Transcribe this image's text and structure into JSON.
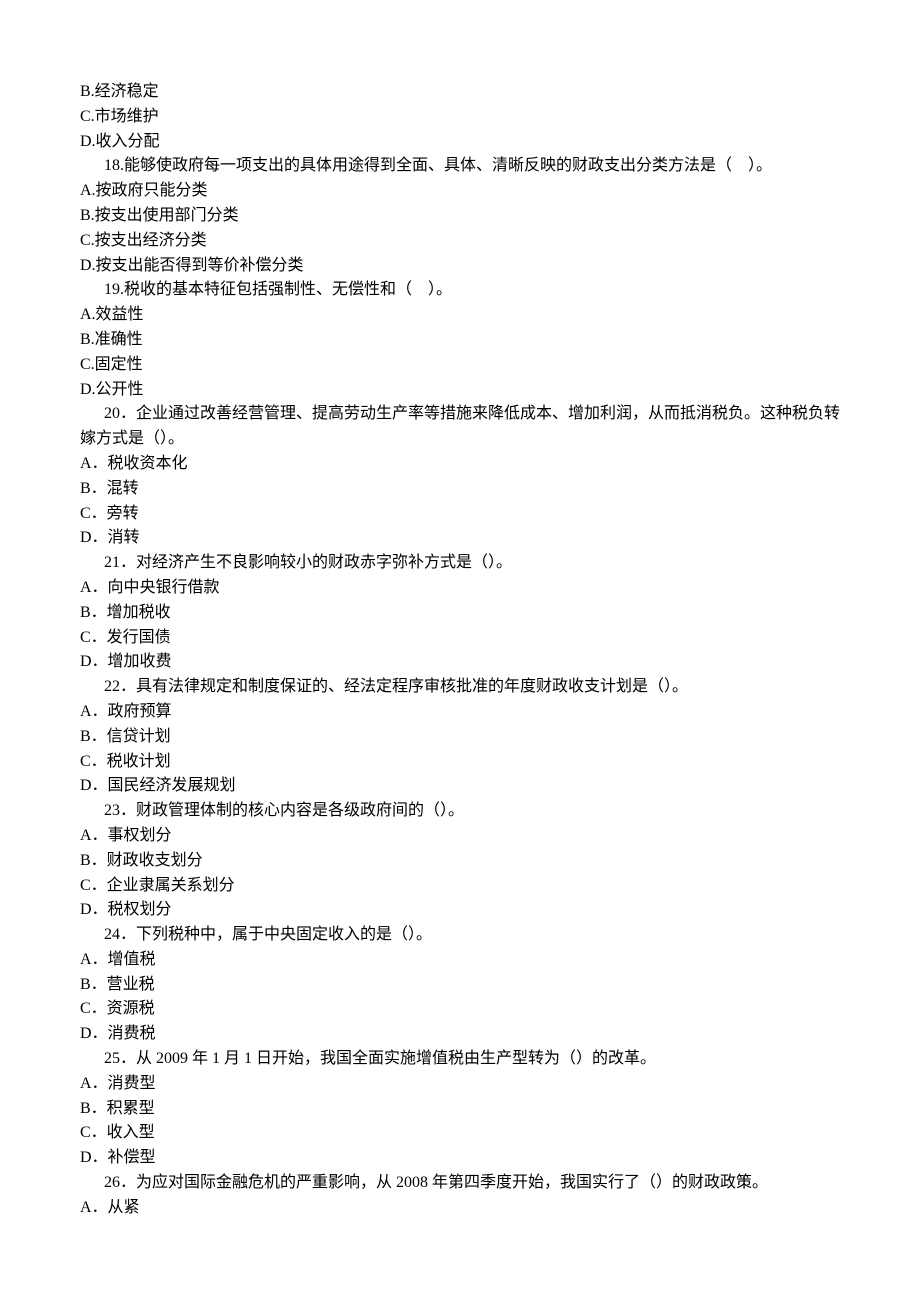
{
  "lines": [
    "B.经济稳定",
    "C.市场维护",
    "D.收入分配"
  ],
  "q18": {
    "stem": "18.能够使政府每一项支出的具体用途得到全面、具体、清晰反映的财政支出分类方法是（　）。",
    "A": "A.按政府只能分类",
    "B": "B.按支出使用部门分类",
    "C": "C.按支出经济分类",
    "D": "D.按支出能否得到等价补偿分类"
  },
  "q19": {
    "stem": "19.税收的基本特征包括强制性、无偿性和（　）。",
    "A": "A.效益性",
    "B": "B.准确性",
    "C": "C.固定性",
    "D": "D.公开性"
  },
  "q20": {
    "stem": "20．企业通过改善经营管理、提高劳动生产率等措施来降低成本、增加利润，从而抵消税负。这种税负转嫁方式是（）。",
    "A": "A．税收资本化",
    "B": "B．混转",
    "C": "C．旁转",
    "D": "D．消转"
  },
  "q21": {
    "stem": "21．对经济产生不良影响较小的财政赤字弥补方式是（）。",
    "A": "A．向中央银行借款",
    "B": "B．增加税收",
    "C": "C．发行国债",
    "D": "D．增加收费"
  },
  "q22": {
    "stem": "22．具有法律规定和制度保证的、经法定程序审核批准的年度财政收支计划是（）。",
    "A": "A．政府预算",
    "B": "B．信贷计划",
    "C": "C．税收计划",
    "D": "D．国民经济发展规划"
  },
  "q23": {
    "stem": "23．财政管理体制的核心内容是各级政府间的（）。",
    "A": "A．事权划分",
    "B": "B．财政收支划分",
    "C": "C．企业隶属关系划分",
    "D": "D．税权划分"
  },
  "q24": {
    "stem": "24．下列税种中，属于中央固定收入的是（）。",
    "A": "A．增值税",
    "B": "B．营业税",
    "C": "C．资源税",
    "D": "D．消费税"
  },
  "q25": {
    "stem": "25．从 2009 年 1 月 1 日开始，我国全面实施增值税由生产型转为（）的改革。",
    "A": "A．消费型",
    "B": "B．积累型",
    "C": "C．收入型",
    "D": "D．补偿型"
  },
  "q26": {
    "stem": "26．为应对国际金融危机的严重影响，从 2008 年第四季度开始，我国实行了（）的财政政策。",
    "A": "A．从紧"
  }
}
